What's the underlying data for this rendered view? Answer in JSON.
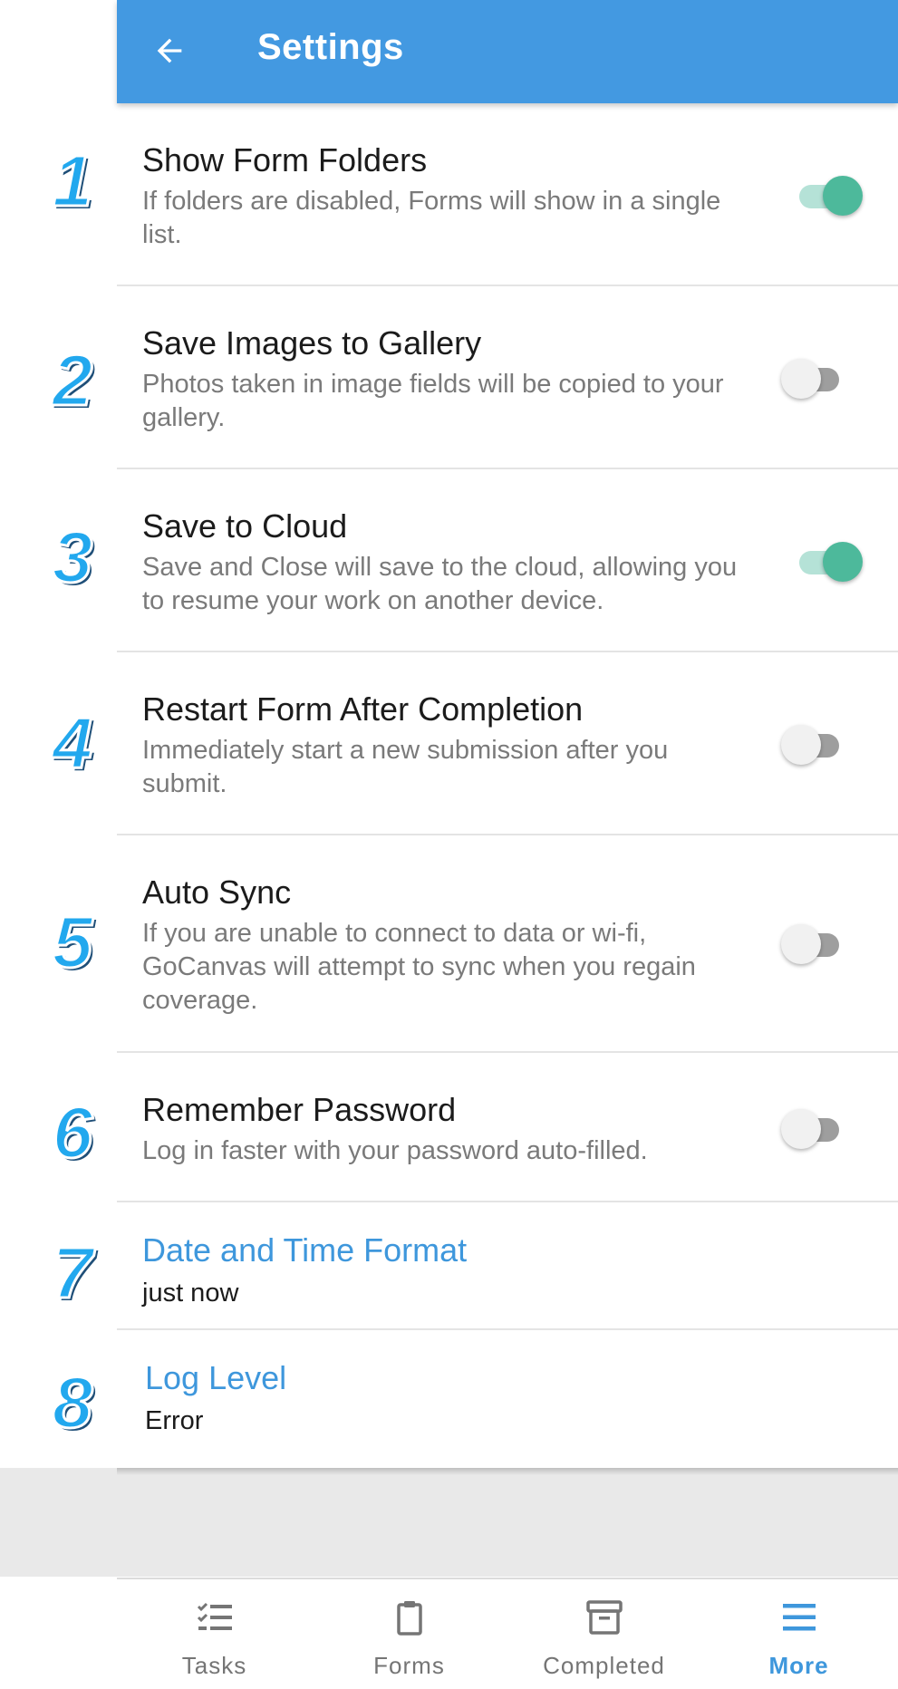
{
  "app_bar": {
    "title": "Settings"
  },
  "settings": [
    {
      "number": "1",
      "title": "Show Form Folders",
      "description": "If folders are disabled, Forms will show in a single list.",
      "enabled": true
    },
    {
      "number": "2",
      "title": "Save Images to Gallery",
      "description": "Photos taken in image fields will be copied to your gallery.",
      "enabled": false
    },
    {
      "number": "3",
      "title": "Save to Cloud",
      "description": "Save and Close will save to the cloud, allowing you to resume your work on another device.",
      "enabled": true
    },
    {
      "number": "4",
      "title": "Restart Form After Completion",
      "description": "Immediately start a new submission after you submit.",
      "enabled": false
    },
    {
      "number": "5",
      "title": "Auto Sync",
      "description": "If you are unable to connect to data or wi-fi, GoCanvas will attempt to sync when you regain coverage.",
      "enabled": false
    },
    {
      "number": "6",
      "title": "Remember Password",
      "description": "Log in faster with your password auto-filled.",
      "enabled": false
    }
  ],
  "options": [
    {
      "number": "7",
      "title": "Date and Time Format",
      "value": "just now"
    },
    {
      "number": "8",
      "title": "Log Level",
      "value": "Error"
    }
  ],
  "bottom_nav": {
    "items": [
      {
        "label": "Tasks",
        "icon": "tasks-icon",
        "active": false
      },
      {
        "label": "Forms",
        "icon": "clipboard-icon",
        "active": false
      },
      {
        "label": "Completed",
        "icon": "archive-icon",
        "active": false
      },
      {
        "label": "More",
        "icon": "menu-icon",
        "active": true
      }
    ]
  },
  "colors": {
    "app_bar": "#4399e1",
    "toggle_on": "#4db99b",
    "link": "#3e97dc",
    "step_number": "#22a8ee"
  }
}
